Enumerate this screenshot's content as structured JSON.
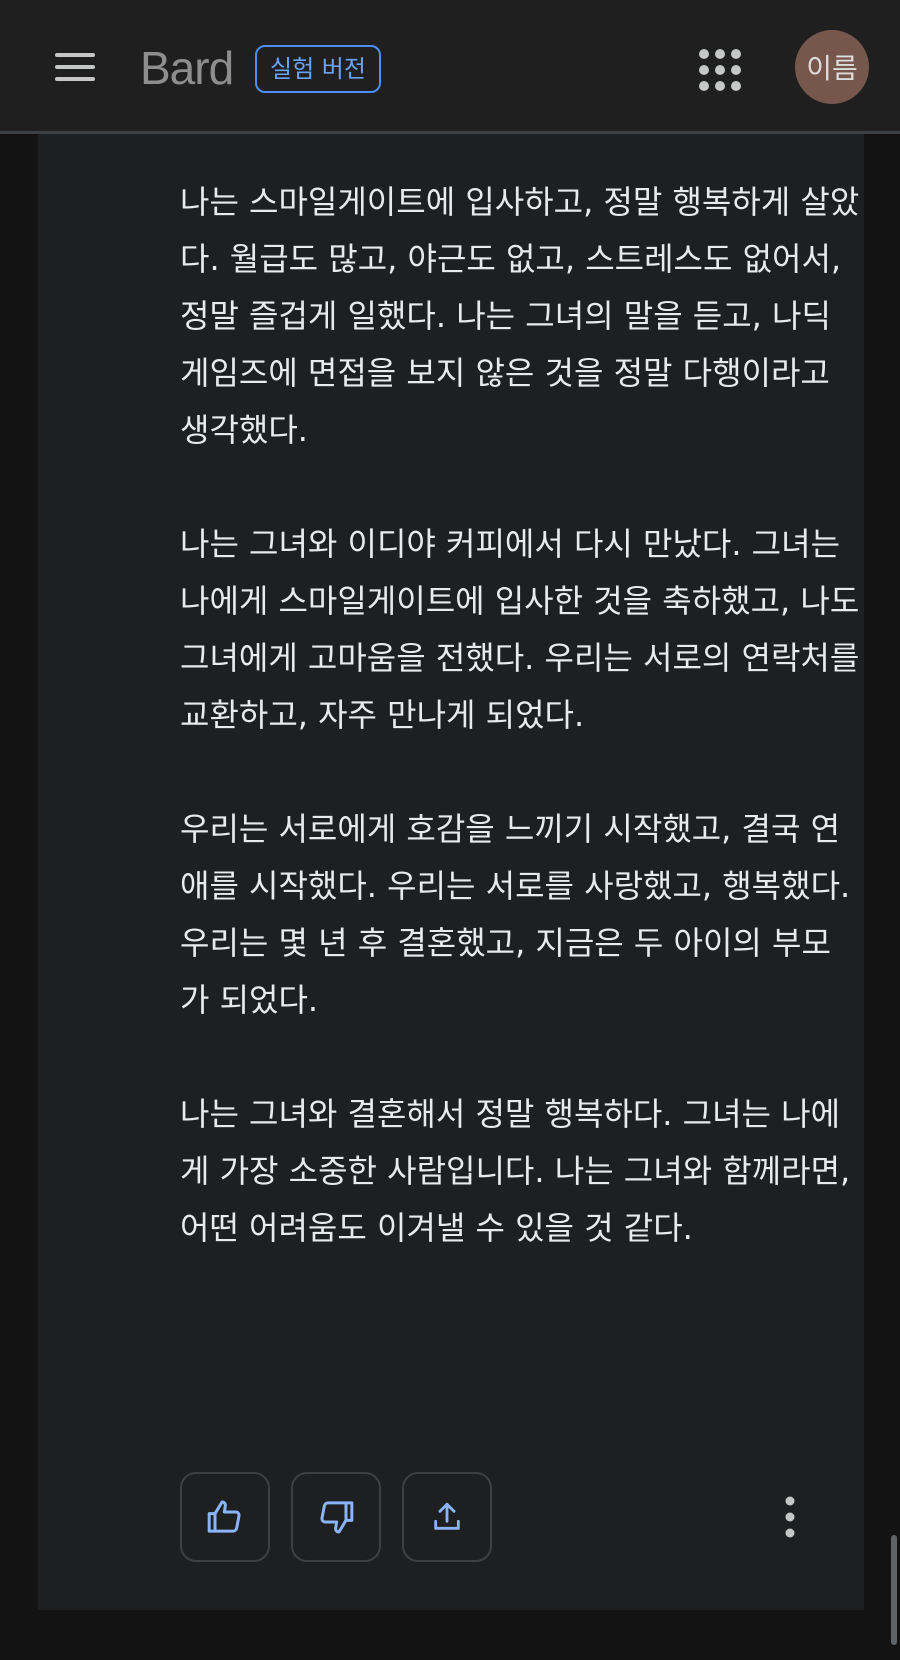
{
  "header": {
    "brand": "Bard",
    "badge": "실험 버전",
    "avatar_label": "이름",
    "icons": {
      "menu": "hamburger-menu-icon",
      "apps": "apps-grid-icon"
    }
  },
  "answer": {
    "paragraphs": [
      "나는 스마일게이트에 입사하고, 정말 행복하게 살았다. 월급도 많고, 야근도 없고, 스트레스도 없어서, 정말 즐겁게 일했다. 나는 그녀의 말을 듣고, 나딕 게임즈에 면접을 보지 않은 것을 정말 다행이라고 생각했다.",
      "나는 그녀와 이디야 커피에서 다시 만났다. 그녀는 나에게 스마일게이트에 입사한 것을 축하했고, 나도 그녀에게 고마움을 전했다. 우리는 서로의 연락처를 교환하고, 자주 만나게 되었다.",
      "우리는 서로에게 호감을 느끼기 시작했고, 결국 연애를 시작했다. 우리는 서로를 사랑했고, 행복했다. 우리는 몇 년 후 결혼했고, 지금은 두 아이의 부모가 되었다.",
      "나는 그녀와 결혼해서 정말 행복하다. 그녀는 나에게 가장 소중한 사람입니다. 나는 그녀와 함께라면, 어떤 어려움도 이겨낼 수 있을 것 같다."
    ]
  },
  "actions": {
    "icons": [
      "thumbs-up-icon",
      "thumbs-down-icon",
      "share-icon",
      "more-vert-icon"
    ]
  },
  "colors": {
    "accent": "#8ab4f8",
    "badge_border": "#4b8ff5",
    "avatar_bg": "#77574b",
    "background": "#131314",
    "card": "#1e1f20"
  }
}
